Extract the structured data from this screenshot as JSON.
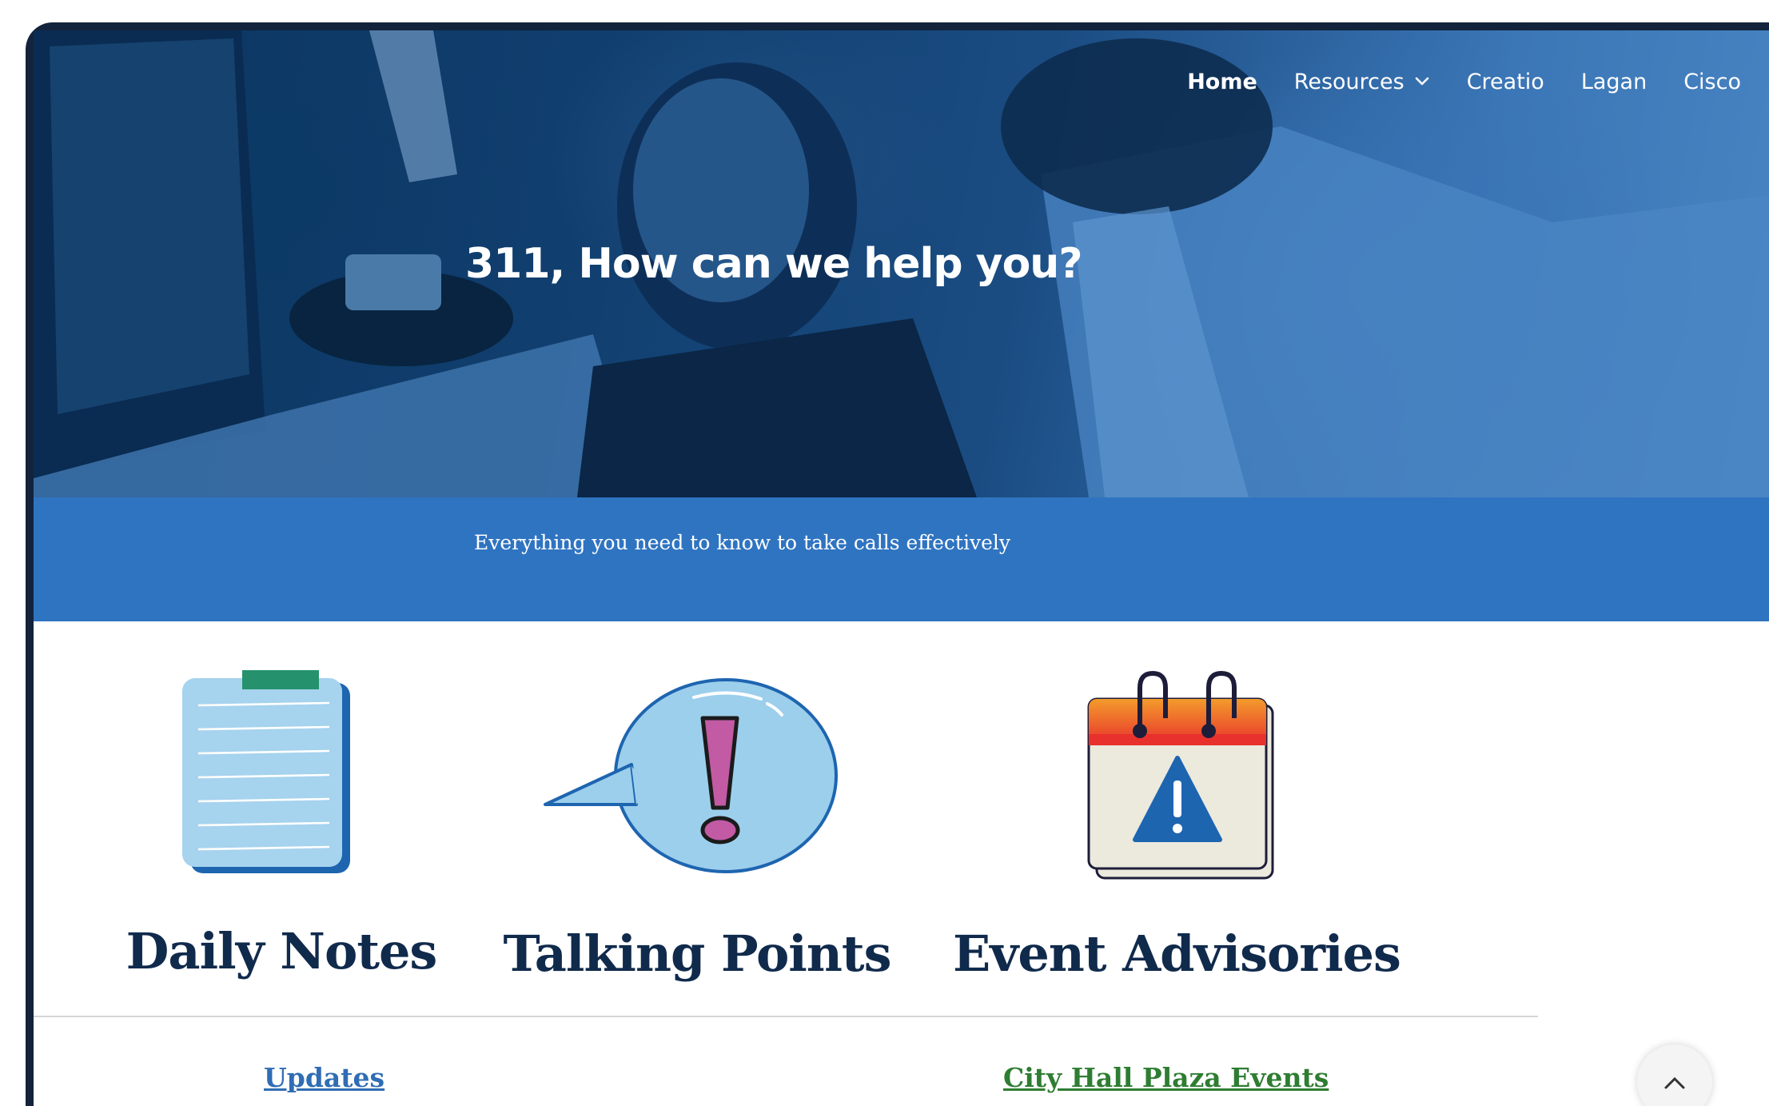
{
  "nav": {
    "items": [
      {
        "label": "Home",
        "active": true
      },
      {
        "label": "Resources",
        "active": false,
        "has_dropdown": true
      },
      {
        "label": "Creatio",
        "active": false
      },
      {
        "label": "Lagan",
        "active": false
      },
      {
        "label": "Cisco",
        "active": false
      }
    ],
    "search_icon": "search-icon"
  },
  "hero": {
    "title": "311, How can we help you?"
  },
  "band": {
    "tagline": "Everything you need to know to take calls effectively"
  },
  "tiles": [
    {
      "label": "Daily Notes",
      "icon": "notepad-icon"
    },
    {
      "label": "Talking Points",
      "icon": "speech-bubble-exclamation-icon"
    },
    {
      "label": "Event Advisories",
      "icon": "calendar-warning-icon"
    }
  ],
  "links": {
    "updates": "Updates",
    "city_hall": "City Hall Plaza Events"
  },
  "colors": {
    "band": "#2f74c1",
    "tile_text": "#102a4c",
    "updates_link": "#2f6db4",
    "city_hall_link": "#2e7d32"
  }
}
